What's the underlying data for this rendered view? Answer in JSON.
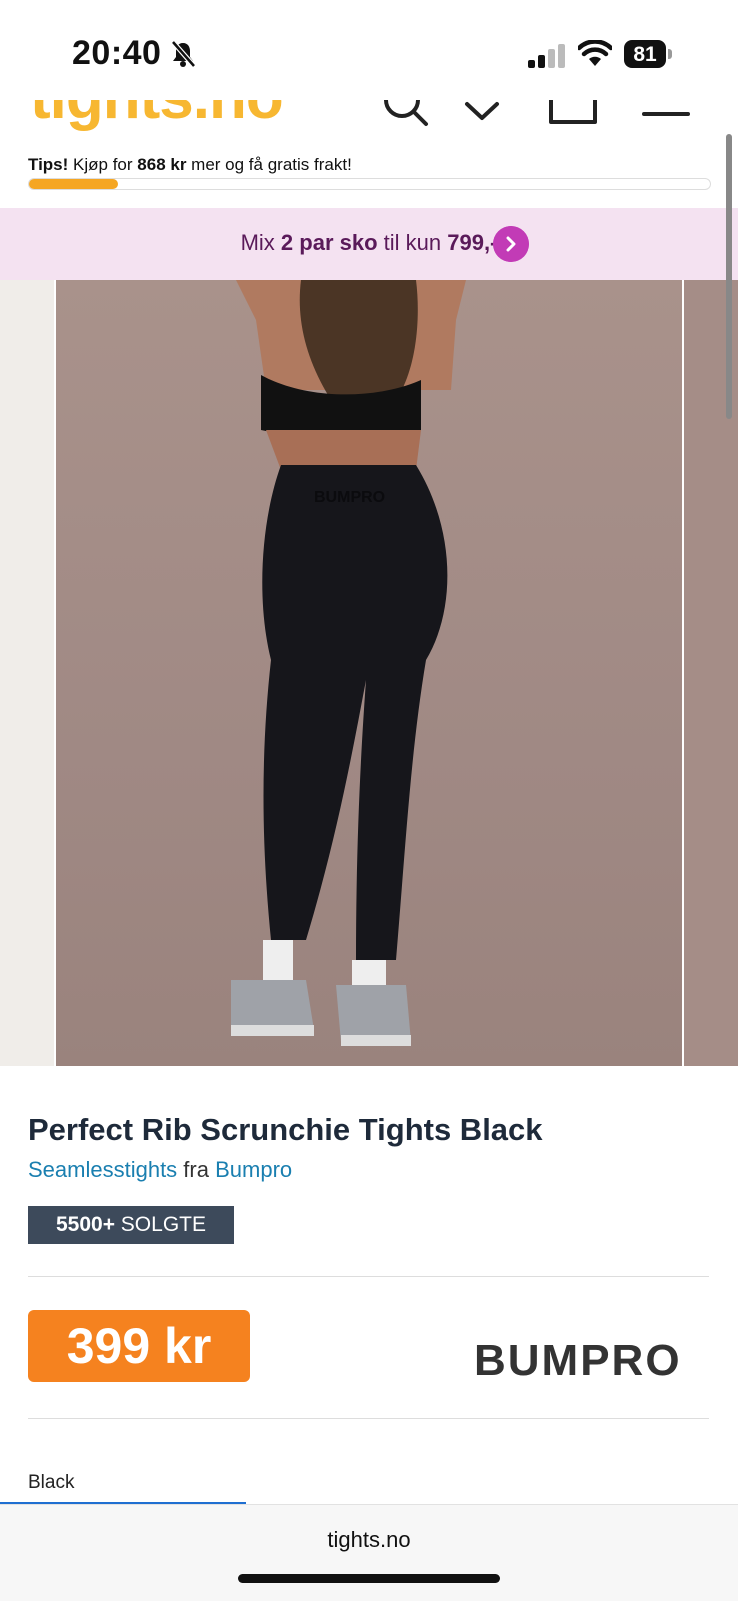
{
  "status": {
    "time": "20:40",
    "battery": "81"
  },
  "header": {
    "logo": "tights.no",
    "tips_label": "Tips!",
    "tips_pre": " Kjøp for ",
    "tips_amount": "868 kr",
    "tips_post": " mer og få gratis frakt!",
    "progress_fraction": 0.13
  },
  "promo": {
    "part1": "Mix ",
    "part2": "2 par sko",
    "part3": " til kun ",
    "part4": "799,-"
  },
  "product": {
    "title": "Perfect Rib Scrunchie Tights Black",
    "category": "Seamlesstights",
    "fra": " fra ",
    "brand_link": "Bumpro",
    "sold_count": "5500+",
    "sold_label": " SOLGTE",
    "price": "399 kr",
    "brand_logo": "BUMPRO",
    "color": "Black"
  },
  "browser": {
    "url": "tights.no"
  },
  "colors": {
    "accent_orange": "#f5821f",
    "logo_yellow": "#f7b731",
    "promo_bg": "#f4e2f1",
    "promo_btn": "#c23bb6",
    "link_blue": "#1a7fb0",
    "tab_blue": "#1f6fd1"
  }
}
